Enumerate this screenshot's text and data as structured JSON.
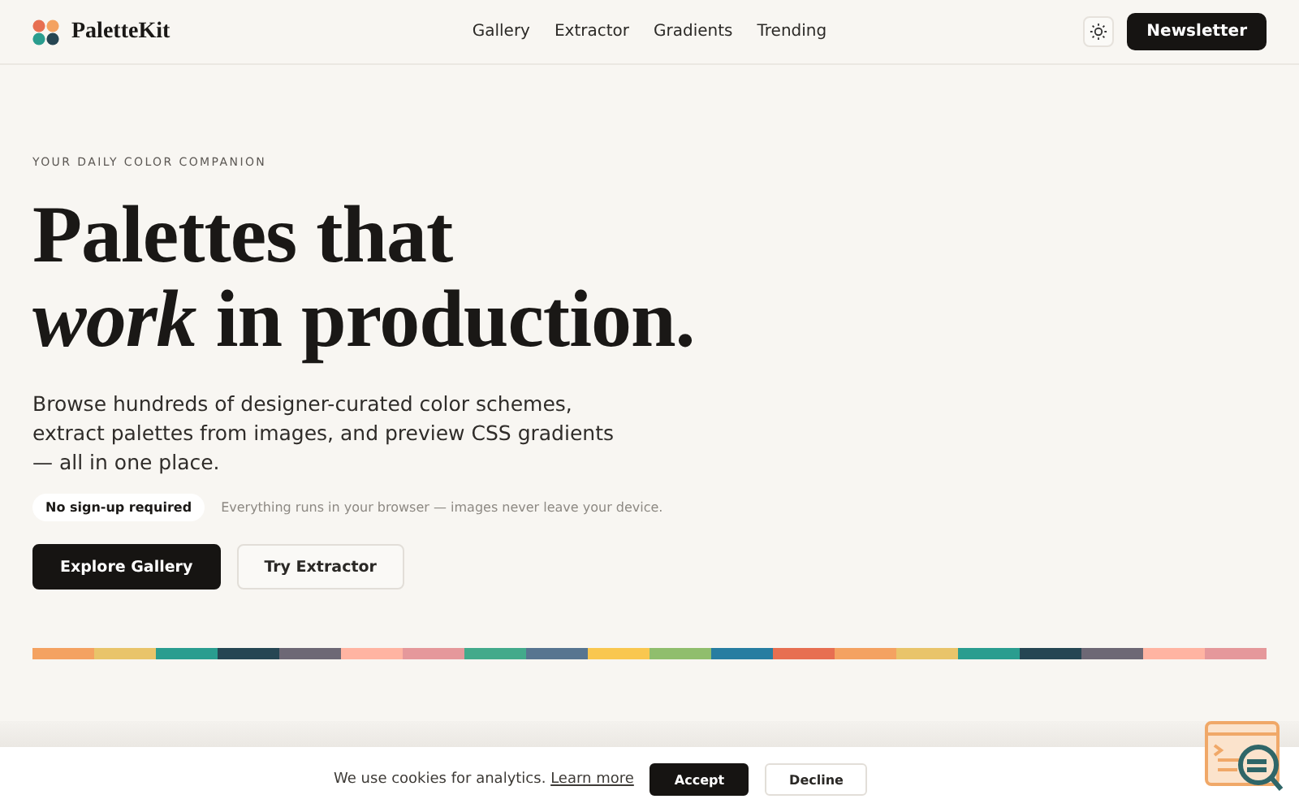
{
  "brand": {
    "name": "PaletteKit"
  },
  "nav": [
    {
      "label": "Gallery"
    },
    {
      "label": "Extractor"
    },
    {
      "label": "Gradients"
    },
    {
      "label": "Trending"
    }
  ],
  "header_button": "Newsletter",
  "hero": {
    "eyebrow": "YOUR DAILY COLOR COMPANION",
    "title_line_1": "Palettes that",
    "title_line_2_emphasis": "work",
    "title_line_2_rest": "in production.",
    "description": "Browse hundreds of designer-curated color schemes, extract palettes from images, and preview CSS gradients — all in one place.",
    "badge": "No sign-up required",
    "note": "Everything runs in your browser — images never leave your device.",
    "buttons": [
      {
        "label": "Explore Gallery",
        "kind": "primary"
      },
      {
        "label": "Try Extractor",
        "kind": "secondary"
      }
    ]
  },
  "swatches": [
    {
      "color": "#f4a261"
    },
    {
      "color": "#e9c46a"
    },
    {
      "color": "#2a9d8f"
    },
    {
      "color": "#264653"
    },
    {
      "color": "#6d6875"
    },
    {
      "color": "#ffb4a2"
    },
    {
      "color": "#e5989b"
    },
    {
      "color": "#43aa8b"
    },
    {
      "color": "#577590"
    },
    {
      "color": "#f9c74f"
    },
    {
      "color": "#90be6d"
    },
    {
      "color": "#277da1"
    },
    {
      "color": "#e76f51"
    },
    {
      "color": "#f4a261"
    },
    {
      "color": "#e9c46a"
    },
    {
      "color": "#2a9d8f"
    },
    {
      "color": "#264653"
    },
    {
      "color": "#6d6875"
    },
    {
      "color": "#ffb4a2"
    },
    {
      "color": "#e5989b"
    }
  ],
  "cookie_bar": {
    "text": "We use cookies for analytics.",
    "link": "Learn more",
    "buttons": [
      {
        "label": "Accept",
        "kind": "primary"
      },
      {
        "label": "Decline",
        "kind": "secondary"
      }
    ]
  }
}
